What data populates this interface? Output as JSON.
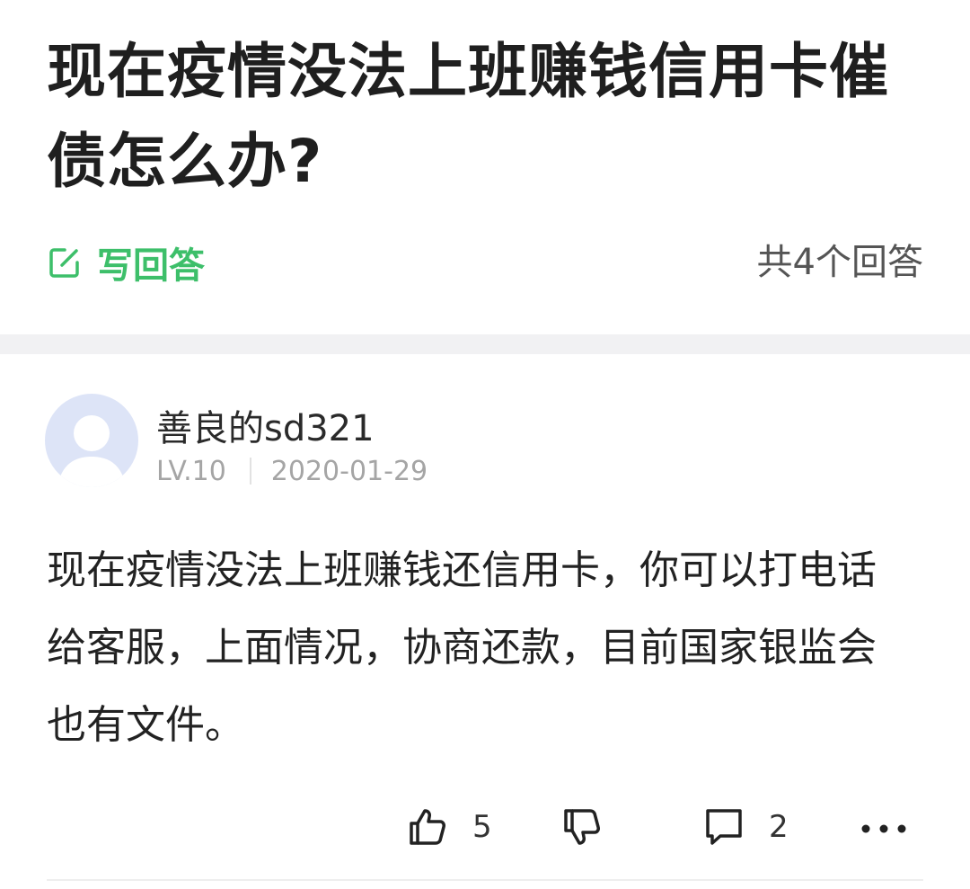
{
  "question": {
    "title": "现在疫情没法上班赚钱信用卡催债怎么办?"
  },
  "question_bar": {
    "write_answer_label": "写回答",
    "answer_count_text": "共4个回答"
  },
  "answer": {
    "username": "善良的sd321",
    "level": "LV.10",
    "date": "2020-01-29",
    "body": "现在疫情没法上班赚钱还信用卡，你可以打电话给客服，上面情况，协商还款，目前国家银监会也有文件。",
    "like_count": "5",
    "comment_count": "2"
  },
  "icons": {
    "write": "edit-square-icon",
    "like": "thumbs-up-icon",
    "dislike": "thumbs-down-icon",
    "comment": "comment-icon",
    "more": "more-dots-icon"
  },
  "colors": {
    "accent_green": "#3dbf6a",
    "avatar_bg": "#dde4f7",
    "divider_band": "#f1f1f3"
  }
}
